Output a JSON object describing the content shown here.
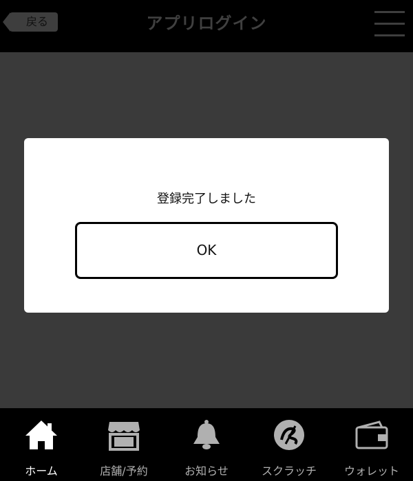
{
  "header": {
    "back_label": "戻る",
    "title": "アプリログイン",
    "menu_icon": "hamburger-icon"
  },
  "dialog": {
    "message": "登録完了しました",
    "ok_label": "OK"
  },
  "tabbar": {
    "items": [
      {
        "label": "ホーム",
        "icon": "home-icon",
        "active": true
      },
      {
        "label": "店舗/予約",
        "icon": "store-icon",
        "active": false
      },
      {
        "label": "お知らせ",
        "icon": "bell-icon",
        "active": false
      },
      {
        "label": "スクラッチ",
        "icon": "scratch-icon",
        "active": false
      },
      {
        "label": "ウォレット",
        "icon": "wallet-icon",
        "active": false
      }
    ]
  },
  "colors": {
    "background": "#3a3a3a",
    "header": "#000000",
    "dialog": "#ffffff",
    "tab_active": "#ffffff",
    "tab_inactive": "#b0b0b0"
  }
}
